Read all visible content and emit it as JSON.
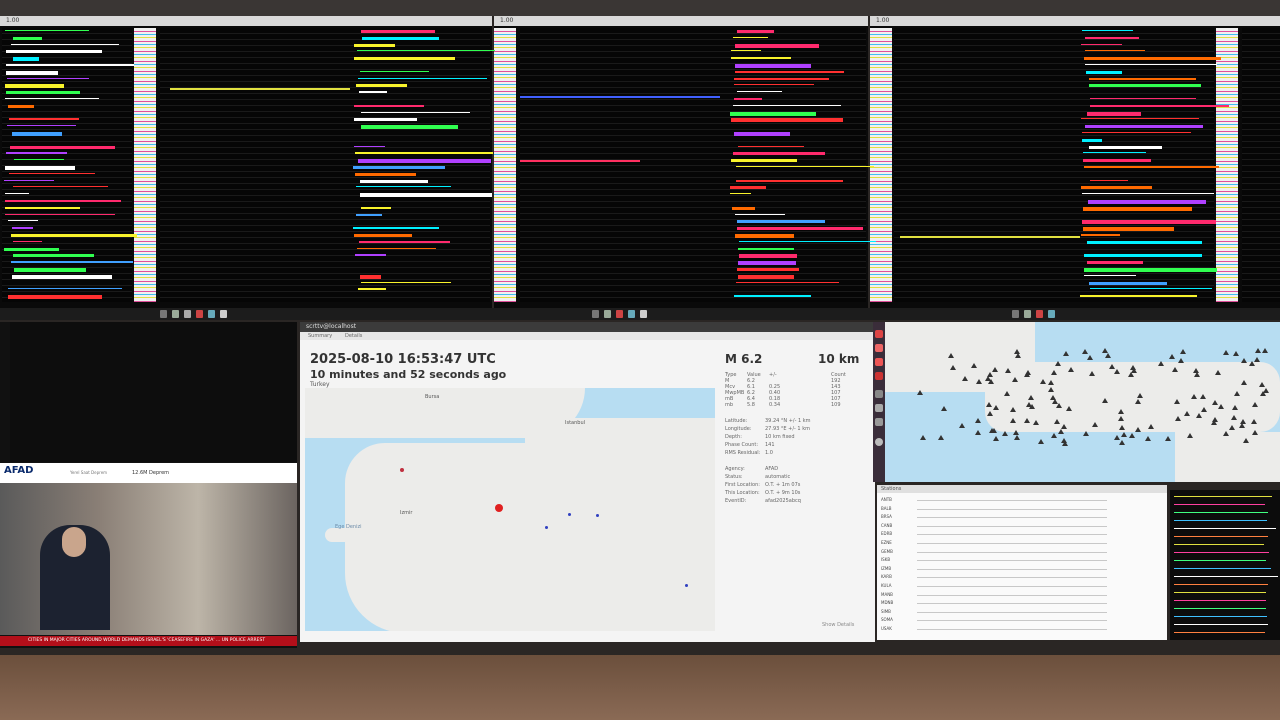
{
  "top_screens": {
    "window1_title": "1.00",
    "window2_title": "1.00",
    "window3_title": "1.00"
  },
  "event": {
    "window_title": "scrttv@localhost",
    "tabs": [
      "Summary",
      "Details"
    ],
    "datetime": "2025-08-10 16:53:47 UTC",
    "elapsed": "10 minutes and 52 seconds ago",
    "region": "Turkey",
    "magnitude_label": "M 6.2",
    "depth_label": "10 km",
    "mag_table_header": [
      "Type",
      "Value",
      "+/-",
      "Count"
    ],
    "mag_table_rows": [
      [
        "M",
        "6.2",
        "",
        "192"
      ],
      [
        "Mcv",
        "6.1",
        "0.25",
        "143"
      ],
      [
        "MwpMB",
        "6.2",
        "0.40",
        "107"
      ],
      [
        "mB",
        "6.4",
        "0.18",
        "107"
      ],
      [
        "mb",
        "5.8",
        "0.34",
        "109"
      ]
    ],
    "info_rows": [
      {
        "key": "Latitude:",
        "value": "39.24 °N  +/-  1 km"
      },
      {
        "key": "Longitude:",
        "value": "27.93 °E  +/-  1 km"
      },
      {
        "key": "Depth:",
        "value": "10 km   fixed"
      },
      {
        "key": "Phase Count:",
        "value": "141"
      },
      {
        "key": "RMS Residual:",
        "value": "1.0"
      },
      {
        "key": "",
        "value": ""
      },
      {
        "key": "Agency:",
        "value": "AFAD"
      },
      {
        "key": "Status:",
        "value": "automatic"
      },
      {
        "key": "First Location:",
        "value": "O.T. + 1m 07s"
      },
      {
        "key": "This Location:",
        "value": "O.T. + 9m 10s"
      },
      {
        "key": "EventID:",
        "value": "afad2025abcq"
      }
    ],
    "map_labels": [
      "Bursa",
      "Istanbul",
      "Izmir",
      "Ege Denizi"
    ],
    "show_details": "Show Details"
  },
  "tv": {
    "channel_logo": "AFAD",
    "sub_label": "Yerel Saat Deprem",
    "headline": "12.6M Deprem",
    "ticker": "CITIES IN MAJOR CITIES AROUND WORLD DEMANDS ISRAEL'S 'CEASEFIRE IN GAZA' ... UN POLICE ARREST"
  },
  "stations": {
    "header": "Stations",
    "codes": [
      "ANTB",
      "BALB",
      "BRSA",
      "CANB",
      "EDRB",
      "EZNE",
      "GEMB",
      "ISKB",
      "IZMB",
      "KARB",
      "KULA",
      "MANB",
      "MDNB",
      "SIMB",
      "SOMA",
      "USAK"
    ]
  },
  "colors": {
    "event_marker": "#e02020",
    "station_marker": "#333333",
    "sea": "#b7ddf2",
    "land": "#ececea",
    "ticker": "#b30f1a"
  }
}
